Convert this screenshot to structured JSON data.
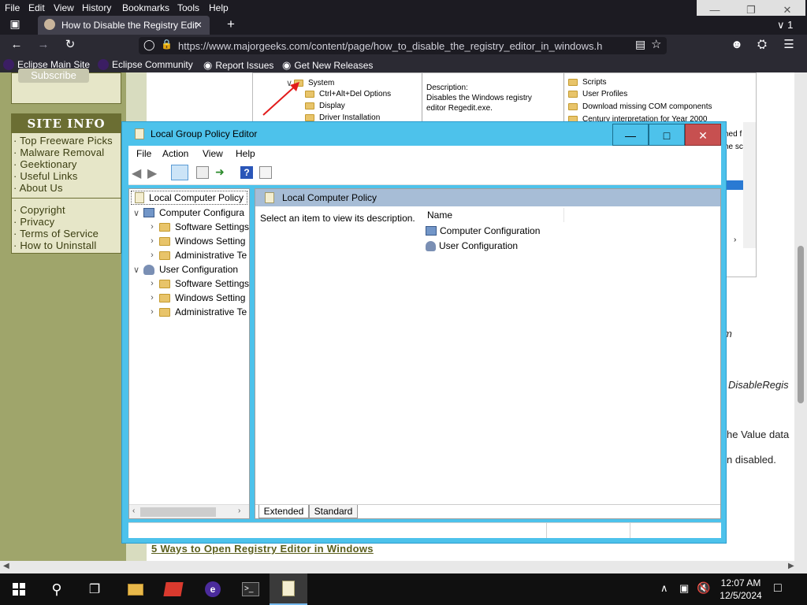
{
  "firefox": {
    "menu": [
      "File",
      "Edit",
      "View",
      "History",
      "Bookmarks",
      "Tools",
      "Help"
    ],
    "tab_title": "How to Disable the Registry Edit",
    "tab_close": "×",
    "new_tab": "+",
    "tab_count": "1",
    "url": "https://www.majorgeeks.com/content/page/how_to_disable_the_registry_editor_in_windows.h",
    "bookmarks": [
      "Eclipse Main Site",
      "Eclipse Community",
      "Report Issues",
      "Get New Releases"
    ]
  },
  "webpage": {
    "subscribe_label": "Subscribe",
    "site_info_heading": "SITE INFO",
    "site_links_1": [
      "Top Freeware Picks",
      "Malware Removal",
      "Geektionary",
      "Useful Links",
      "About Us"
    ],
    "site_links_2": [
      "Copyright",
      "Privacy",
      "Terms of Service",
      "How to Uninstall"
    ],
    "bg_tree": [
      "System",
      "Ctrl+Alt+Del Options",
      "Display",
      "Driver Installation"
    ],
    "bg_description": "Description:\nDisables the Windows registry editor Regedit.exe.",
    "bg_right_list": [
      "Scripts",
      "User Profiles",
      "Download missing COM components",
      "Century interpretation for Year 2000"
    ],
    "bg_fragments": [
      "hed f",
      "he sc",
      "m",
      "DisableRegis",
      "he Value data",
      "n disabled."
    ],
    "bottom_link": "5 Ways to Open Registry Editor in Windows"
  },
  "gpo": {
    "title": "Local Group Policy Editor",
    "menu": [
      "File",
      "Action",
      "View",
      "Help"
    ],
    "tree": {
      "root": "Local Computer Policy",
      "computer": "Computer Configura",
      "computer_children": [
        "Software Settings",
        "Windows Setting",
        "Administrative Te"
      ],
      "user": "User Configuration",
      "user_children": [
        "Software Settings",
        "Windows Setting",
        "Administrative Te"
      ]
    },
    "header": "Local Computer Policy",
    "description": "Select an item to view its description.",
    "column_name": "Name",
    "items": [
      "Computer Configuration",
      "User Configuration"
    ],
    "tabs": [
      "Extended",
      "Standard"
    ]
  },
  "taskbar": {
    "time": "12:07 AM",
    "date": "12/5/2024"
  }
}
